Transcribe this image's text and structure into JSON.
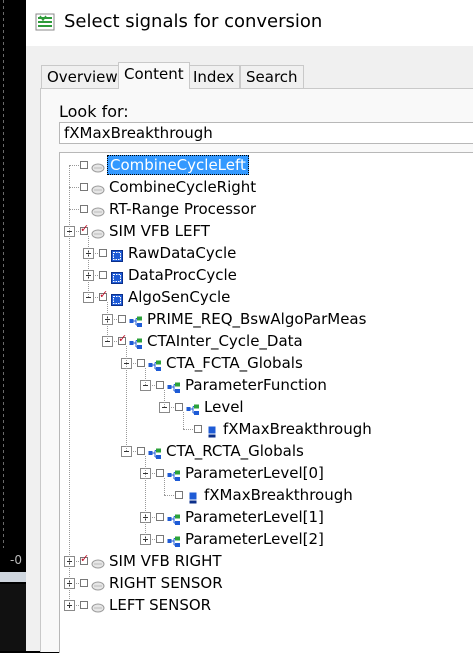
{
  "window": {
    "title": "Select signals for conversion",
    "title_icon": "signals-app-icon"
  },
  "background": {
    "stub_text": "-0"
  },
  "tabs": [
    {
      "label": "Overview",
      "active": false
    },
    {
      "label": "Content",
      "active": true
    },
    {
      "label": "Index",
      "active": false
    },
    {
      "label": "Search",
      "active": false
    }
  ],
  "search": {
    "label": "Look for:",
    "value": "fXMaxBreakthrough"
  },
  "tree": [
    {
      "label": "CombineCycleLeft",
      "depth": 0,
      "expander": "none",
      "checked": false,
      "icon": "cycle-icon",
      "selected": true
    },
    {
      "label": "CombineCycleRight",
      "depth": 0,
      "expander": "none",
      "checked": false,
      "icon": "cycle-icon",
      "selected": false
    },
    {
      "label": "RT-Range Processor",
      "depth": 0,
      "expander": "none",
      "checked": false,
      "icon": "cycle-icon",
      "selected": false
    },
    {
      "label": "SIM VFB LEFT",
      "depth": 0,
      "expander": "minus",
      "checked": true,
      "icon": "cycle-icon",
      "selected": false
    },
    {
      "label": "RawDataCycle",
      "depth": 1,
      "expander": "plus",
      "checked": false,
      "icon": "module-icon",
      "selected": false
    },
    {
      "label": "DataProcCycle",
      "depth": 1,
      "expander": "plus",
      "checked": false,
      "icon": "module-icon",
      "selected": false
    },
    {
      "label": "AlgoSenCycle",
      "depth": 1,
      "expander": "minus",
      "checked": true,
      "icon": "module-icon",
      "selected": false
    },
    {
      "label": "PRIME_REQ_BswAlgoParMeas",
      "depth": 2,
      "expander": "plus",
      "checked": false,
      "icon": "struct-icon",
      "selected": false
    },
    {
      "label": "CTAInter_Cycle_Data",
      "depth": 2,
      "expander": "minus",
      "checked": true,
      "icon": "struct-icon",
      "selected": false
    },
    {
      "label": "CTA_FCTA_Globals",
      "depth": 3,
      "expander": "minus",
      "checked": false,
      "icon": "struct-icon",
      "selected": false
    },
    {
      "label": "ParameterFunction",
      "depth": 4,
      "expander": "minus",
      "checked": false,
      "icon": "struct-icon",
      "selected": false
    },
    {
      "label": "Level",
      "depth": 5,
      "expander": "minus",
      "checked": false,
      "icon": "struct-icon",
      "selected": false
    },
    {
      "label": "fXMaxBreakthrough",
      "depth": 6,
      "expander": "none",
      "checked": false,
      "icon": "signal-icon",
      "selected": false
    },
    {
      "label": "CTA_RCTA_Globals",
      "depth": 3,
      "expander": "minus",
      "checked": false,
      "icon": "struct-icon",
      "selected": false
    },
    {
      "label": "ParameterLevel[0]",
      "depth": 4,
      "expander": "minus",
      "checked": false,
      "icon": "struct-icon",
      "selected": false
    },
    {
      "label": "fXMaxBreakthrough",
      "depth": 5,
      "expander": "none",
      "checked": false,
      "icon": "signal-icon",
      "selected": false
    },
    {
      "label": "ParameterLevel[1]",
      "depth": 4,
      "expander": "plus",
      "checked": false,
      "icon": "struct-icon",
      "selected": false
    },
    {
      "label": "ParameterLevel[2]",
      "depth": 4,
      "expander": "plus",
      "checked": false,
      "icon": "struct-icon",
      "selected": false
    },
    {
      "label": "SIM VFB RIGHT",
      "depth": 0,
      "expander": "plus",
      "checked": true,
      "icon": "cycle-icon",
      "selected": false
    },
    {
      "label": "RIGHT SENSOR",
      "depth": 0,
      "expander": "plus",
      "checked": false,
      "icon": "cycle-icon",
      "selected": false
    },
    {
      "label": "LEFT SENSOR",
      "depth": 0,
      "expander": "plus",
      "checked": false,
      "icon": "cycle-icon",
      "selected": false
    }
  ]
}
